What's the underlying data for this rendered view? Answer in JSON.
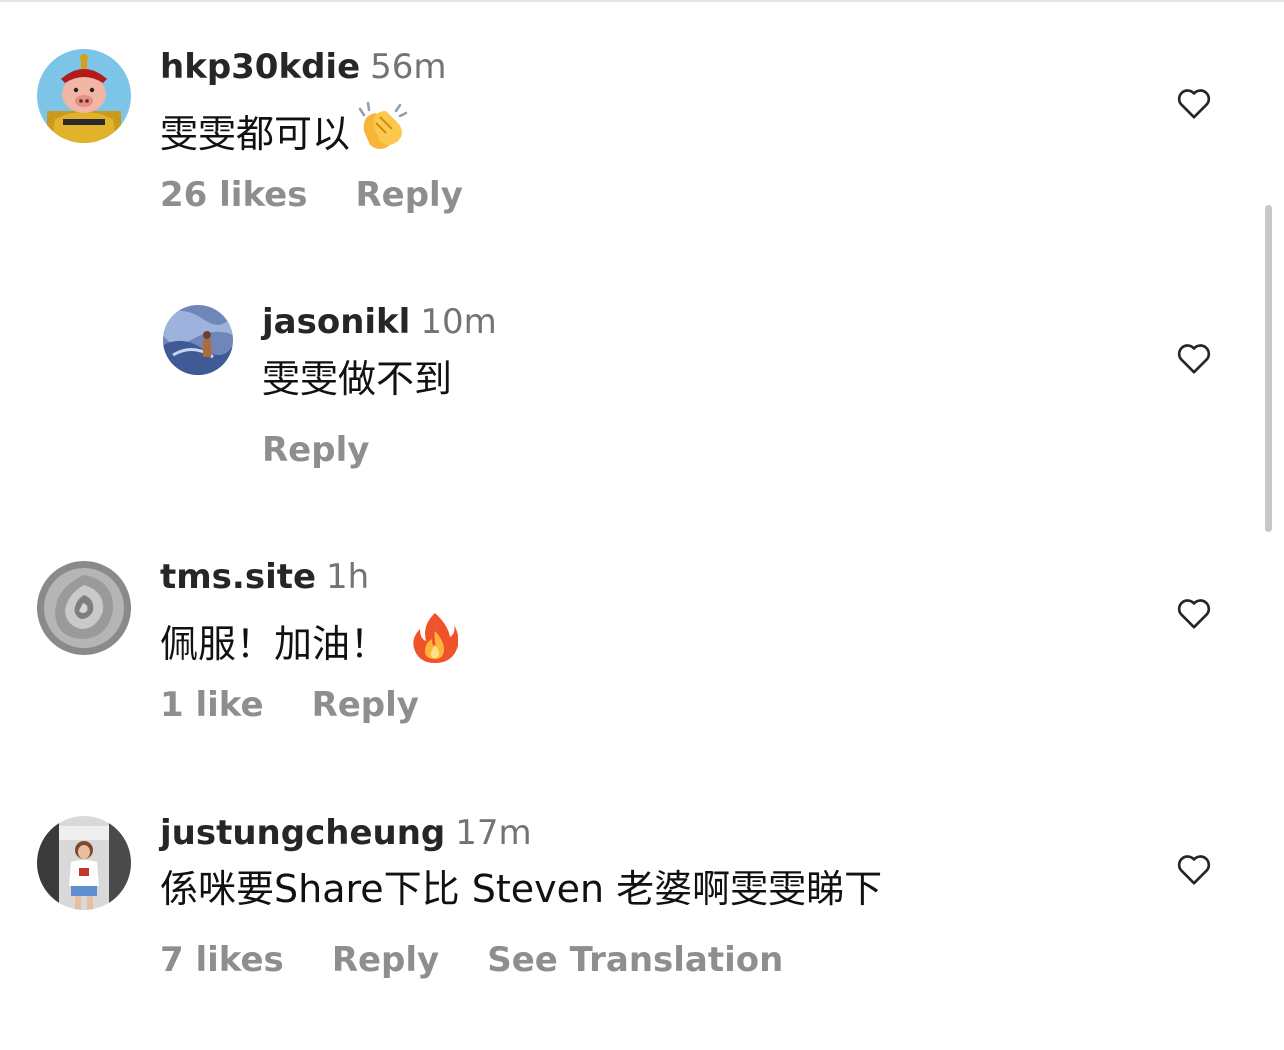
{
  "comments": [
    {
      "username": "hkp30kdie",
      "time": "56m",
      "text": "雯雯都可以",
      "emoji": "clapping-hands-emoji",
      "likes": "26 likes",
      "reply": "Reply",
      "avatar": "emperor-pig-avatar"
    },
    {
      "username": "jasonikl",
      "time": "10m",
      "text": "雯雯做不到",
      "reply": "Reply",
      "avatar": "blue-photo-avatar"
    },
    {
      "username": "tms.site",
      "time": "1h",
      "text": "佩服！加油！",
      "emoji": "fire-emoji",
      "likes": "1 like",
      "reply": "Reply",
      "avatar": "grey-rose-avatar"
    },
    {
      "username": "justungcheung",
      "time": "17m",
      "text": "係咪要Share下比 Steven 老婆啊雯雯睇下",
      "likes": "7 likes",
      "reply": "Reply",
      "translation": "See Translation",
      "avatar": "person-photo-avatar"
    }
  ],
  "icons": {
    "like": "heart-outline-icon"
  },
  "colors": {
    "text": "#262626",
    "muted": "#8e8e8e",
    "time": "#737373",
    "scrollbar": "#c7c7c7"
  }
}
